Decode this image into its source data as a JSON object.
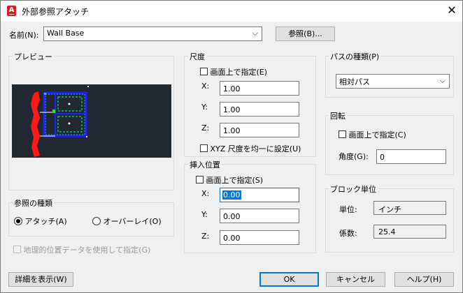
{
  "window": {
    "title": "外部参照アタッチ",
    "app_icon": "A"
  },
  "name_row": {
    "label": "名前(N):",
    "value": "Wall Base",
    "browse_button": "参照(B)..."
  },
  "preview": {
    "label": "プレビュー"
  },
  "ref_type": {
    "label": "参照の種類",
    "attach": "アタッチ(A)",
    "overlay": "オーバーレイ(O)",
    "selected": "attach"
  },
  "geo": {
    "label": "地理的位置データを使用して指定(G)"
  },
  "scale": {
    "label": "尺度",
    "onscreen": "画面上で指定(E)",
    "x_label": "X:",
    "x": "1.00",
    "y_label": "Y:",
    "y": "1.00",
    "z_label": "Z:",
    "z": "1.00",
    "uniform": "XYZ 尺度を均一に設定(U)"
  },
  "insertion": {
    "label": "挿入位置",
    "onscreen": "画面上で指定(S)",
    "x_label": "X:",
    "x": "0.00",
    "y_label": "Y:",
    "y": "0.00",
    "z_label": "Z:",
    "z": "0.00"
  },
  "path_type": {
    "label": "パスの種類(P)",
    "value": "相対パス"
  },
  "rotation": {
    "label": "回転",
    "onscreen": "画面上で指定(C)",
    "angle_label": "角度(G):",
    "angle": "0"
  },
  "block_unit": {
    "label": "ブロック単位",
    "unit_label": "単位:",
    "unit": "インチ",
    "factor_label": "係数:",
    "factor": "25.4"
  },
  "footer": {
    "details": "詳細を表示(W)",
    "ok": "OK",
    "cancel": "キャンセル",
    "help": "ヘルプ(H)"
  }
}
